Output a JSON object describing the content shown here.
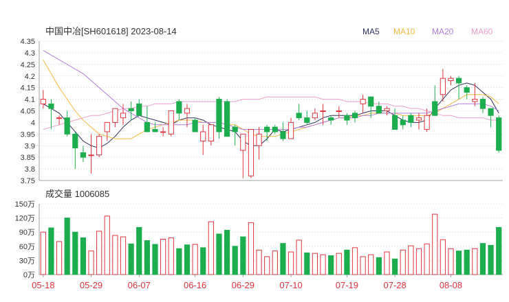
{
  "header": {
    "title": "中国中冶[SH601618] 2023-08-14"
  },
  "legend": [
    {
      "name": "MA5",
      "color": "#2e2e5e"
    },
    {
      "name": "MA10",
      "color": "#f4b740"
    },
    {
      "name": "MA20",
      "color": "#b27be0"
    },
    {
      "name": "MA60",
      "color": "#ee9ecb"
    }
  ],
  "volume_label": "成交量 1006085",
  "colors": {
    "up": "#e0333c",
    "down": "#1cae4e",
    "grid": "#d7d7d7",
    "axis": "#333333",
    "date": "#e0333c"
  },
  "chart_data": [
    {
      "type": "candlestick",
      "title": "中国中冶[SH601618] 2023-08-14",
      "ylim": [
        3.75,
        4.35
      ],
      "y_ticks": [
        "4.35",
        "4.3",
        "4.25",
        "4.2",
        "4.15",
        "4.1",
        "4.05",
        "4",
        "3.95",
        "3.9",
        "3.85",
        "3.8",
        "3.75"
      ],
      "x_ticks": [
        {
          "label": "05-18",
          "index": 0
        },
        {
          "label": "05-29",
          "index": 6
        },
        {
          "label": "06-07",
          "index": 12
        },
        {
          "label": "06-16",
          "index": 19
        },
        {
          "label": "06-29",
          "index": 25
        },
        {
          "label": "07-10",
          "index": 31
        },
        {
          "label": "07-19",
          "index": 38
        },
        {
          "label": "07-28",
          "index": 44
        },
        {
          "label": "08-08",
          "index": 51
        }
      ],
      "ohlc": [
        [
          4.08,
          4.14,
          4.06,
          4.1
        ],
        [
          4.08,
          4.1,
          3.97,
          4.06
        ],
        [
          4.02,
          4.03,
          3.99,
          4.02
        ],
        [
          4.02,
          4.05,
          3.94,
          3.95
        ],
        [
          3.95,
          3.96,
          3.8,
          3.89
        ],
        [
          3.87,
          3.9,
          3.83,
          3.85
        ],
        [
          3.86,
          3.95,
          3.78,
          3.86
        ],
        [
          3.86,
          3.95,
          3.85,
          3.94
        ],
        [
          3.96,
          4.0,
          3.92,
          4.0
        ],
        [
          4.0,
          4.06,
          3.98,
          4.06
        ],
        [
          4.02,
          4.08,
          3.99,
          4.04
        ],
        [
          4.06,
          4.09,
          4.01,
          4.05
        ],
        [
          4.08,
          4.1,
          4.03,
          4.03
        ],
        [
          4.0,
          4.07,
          3.96,
          3.96
        ],
        [
          3.97,
          4.0,
          3.96,
          3.96
        ],
        [
          3.96,
          3.98,
          3.94,
          3.96
        ],
        [
          3.95,
          4.05,
          3.94,
          4.05
        ],
        [
          4.09,
          4.1,
          4.01,
          4.04
        ],
        [
          4.04,
          4.08,
          3.98,
          4.06
        ],
        [
          4.01,
          4.02,
          3.96,
          3.96
        ],
        [
          3.92,
          3.99,
          3.86,
          3.96
        ],
        [
          3.92,
          3.98,
          3.9,
          3.99
        ],
        [
          4.1,
          4.11,
          3.93,
          3.96
        ],
        [
          4.09,
          4.1,
          3.99,
          3.94
        ],
        [
          3.98,
          3.99,
          3.9,
          3.96
        ],
        [
          3.88,
          3.95,
          3.76,
          3.95
        ],
        [
          3.77,
          3.89,
          3.76,
          3.97
        ],
        [
          3.9,
          3.98,
          3.84,
          3.95
        ],
        [
          3.98,
          3.99,
          3.92,
          3.96
        ],
        [
          3.98,
          3.99,
          3.95,
          3.96
        ],
        [
          3.96,
          4.0,
          3.92,
          3.93
        ],
        [
          3.93,
          4.02,
          3.98,
          4.0
        ],
        [
          4.04,
          4.08,
          4.01,
          4.02
        ],
        [
          4.02,
          4.05,
          3.99,
          4.0
        ],
        [
          4.02,
          4.06,
          4.01,
          4.04
        ],
        [
          4.05,
          4.08,
          3.99,
          4.05
        ],
        [
          4.02,
          4.03,
          3.99,
          4.01
        ],
        [
          4.05,
          4.07,
          4.02,
          4.05
        ],
        [
          4.03,
          4.04,
          3.99,
          4.01
        ],
        [
          4.04,
          4.05,
          4.0,
          4.02
        ],
        [
          4.08,
          4.12,
          4.04,
          4.1
        ],
        [
          4.11,
          4.09,
          4.02,
          4.07
        ],
        [
          4.07,
          4.09,
          4.04,
          4.04
        ],
        [
          4.05,
          4.07,
          4.03,
          4.06
        ],
        [
          4.03,
          4.06,
          3.97,
          3.97
        ],
        [
          4.01,
          4.03,
          3.97,
          3.99
        ],
        [
          4.03,
          4.04,
          3.98,
          4.0
        ],
        [
          4.01,
          4.04,
          3.97,
          4.02
        ],
        [
          3.97,
          4.06,
          3.96,
          4.03
        ],
        [
          4.09,
          4.16,
          4.03,
          4.03
        ],
        [
          4.12,
          4.23,
          4.09,
          4.19
        ],
        [
          4.18,
          4.2,
          4.16,
          4.19
        ],
        [
          4.19,
          4.2,
          4.1,
          4.17
        ],
        [
          4.15,
          4.16,
          4.1,
          4.13
        ],
        [
          4.09,
          4.17,
          4.07,
          4.1
        ],
        [
          4.1,
          4.11,
          4.04,
          4.06
        ],
        [
          4.06,
          4.05,
          3.98,
          4.03
        ],
        [
          4.02,
          4.03,
          3.87,
          3.88
        ]
      ],
      "ma5": [
        4.08,
        4.06,
        4.04,
        4.0,
        3.96,
        3.92,
        3.9,
        3.89,
        3.91,
        3.94,
        3.98,
        4.01,
        4.03,
        4.02,
        4.01,
        4.0,
        3.99,
        4.01,
        4.02,
        4.02,
        4.01,
        3.99,
        3.98,
        3.97,
        3.96,
        3.92,
        3.9,
        3.9,
        3.93,
        3.97,
        3.96,
        3.97,
        3.98,
        3.99,
        4.0,
        4.02,
        4.03,
        4.03,
        4.03,
        4.03,
        4.04,
        4.05,
        4.05,
        4.05,
        4.03,
        4.01,
        4.0,
        4.0,
        4.01,
        4.06,
        4.1,
        4.14,
        4.16,
        4.17,
        4.16,
        4.13,
        4.1,
        4.04
      ],
      "ma10": [
        4.27,
        4.21,
        4.15,
        4.1,
        4.05,
        4.01,
        3.98,
        3.95,
        3.94,
        3.93,
        3.93,
        3.93,
        3.95,
        3.97,
        3.98,
        3.99,
        4.0,
        4.01,
        4.01,
        4.01,
        4.0,
        4.0,
        4.0,
        3.99,
        3.99,
        3.97,
        3.95,
        3.94,
        3.94,
        3.94,
        3.95,
        3.96,
        3.97,
        3.98,
        3.99,
        4.0,
        4.01,
        4.02,
        4.02,
        4.03,
        4.03,
        4.04,
        4.04,
        4.04,
        4.04,
        4.03,
        4.03,
        4.03,
        4.03,
        4.04,
        4.06,
        4.08,
        4.1,
        4.12,
        4.12,
        4.12,
        4.11,
        4.08
      ],
      "ma20": [
        4.31,
        4.29,
        4.27,
        4.25,
        4.23,
        4.21,
        4.18,
        4.15,
        4.12,
        4.09,
        4.06,
        4.04,
        4.02,
        4.0,
        3.99,
        3.99,
        3.99,
        3.99,
        3.99,
        4.0,
        4.0,
        4.0,
        4.0,
        3.99,
        3.98,
        3.97,
        3.97,
        3.97,
        3.97,
        3.97,
        3.97,
        3.97,
        3.98,
        3.98,
        3.99,
        4.0,
        4.01,
        4.02,
        4.02,
        4.02,
        4.03,
        4.03,
        4.04,
        4.04,
        4.04,
        4.04,
        4.04,
        4.04,
        4.04,
        4.05,
        4.06,
        4.07,
        4.08,
        4.08,
        4.08,
        4.08,
        4.07,
        4.05
      ],
      "ma60": [
        3.97,
        3.98,
        3.99,
        4.0,
        4.01,
        4.02,
        4.03,
        4.03,
        4.04,
        4.05,
        4.06,
        4.06,
        4.07,
        4.07,
        4.08,
        4.08,
        4.08,
        4.09,
        4.09,
        4.09,
        4.09,
        4.09,
        4.09,
        4.09,
        4.09,
        4.1,
        4.1,
        4.1,
        4.11,
        4.11,
        4.11,
        4.11,
        4.11,
        4.11,
        4.11,
        4.1,
        4.1,
        4.1,
        4.09,
        4.09,
        4.09,
        4.08,
        4.08,
        4.08,
        4.07,
        4.07,
        4.06,
        4.06,
        4.05,
        4.04,
        4.03,
        4.03,
        4.02,
        4.02,
        4.02,
        4.02,
        4.01,
        4.01
      ]
    },
    {
      "type": "bar",
      "title": "成交量 1006085",
      "ylim": [
        0,
        150
      ],
      "y_ticks": [
        "150万",
        "120万",
        "90万",
        "60万",
        "30万",
        "0万"
      ],
      "values": [
        90,
        99,
        70,
        120,
        90,
        78,
        50,
        92,
        124,
        83,
        80,
        65,
        100,
        72,
        64,
        75,
        78,
        55,
        63,
        64,
        57,
        112,
        86,
        94,
        60,
        80,
        110,
        52,
        38,
        50,
        66,
        48,
        73,
        46,
        45,
        42,
        40,
        45,
        52,
        57,
        38,
        42,
        36,
        48,
        33,
        52,
        61,
        55,
        65,
        128,
        74,
        55,
        50,
        52,
        55,
        66,
        62,
        100
      ],
      "up": [
        true,
        false,
        true,
        false,
        false,
        false,
        true,
        true,
        true,
        true,
        true,
        false,
        false,
        false,
        false,
        true,
        true,
        false,
        false,
        true,
        false,
        true,
        false,
        false,
        false,
        false,
        true,
        true,
        true,
        true,
        false,
        true,
        true,
        false,
        true,
        true,
        false,
        true,
        false,
        true,
        true,
        true,
        false,
        true,
        false,
        true,
        true,
        true,
        true,
        true,
        true,
        true,
        false,
        false,
        true,
        false,
        false,
        false
      ]
    }
  ]
}
